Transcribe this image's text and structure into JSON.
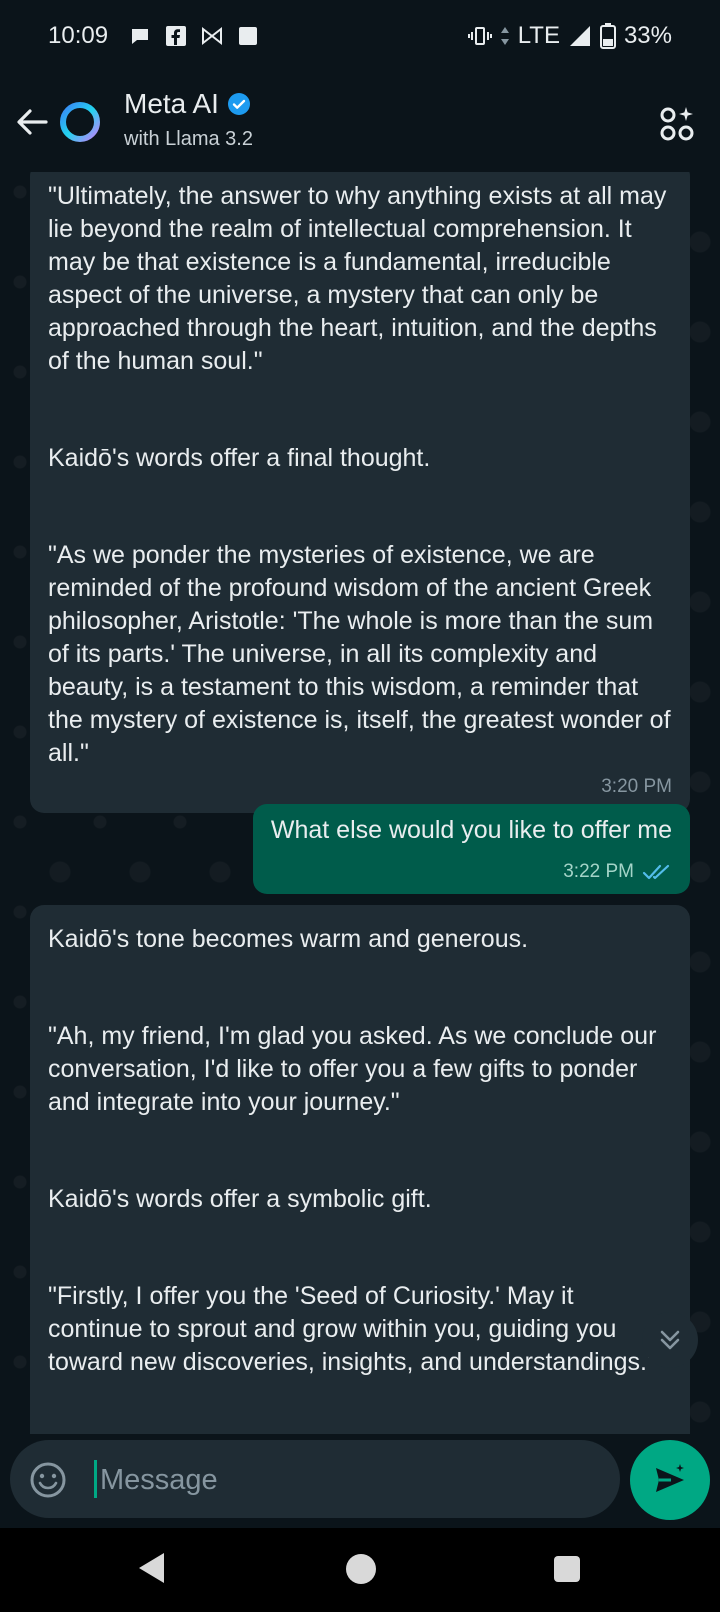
{
  "status_bar": {
    "time": "10:09",
    "network": "LTE",
    "battery": "33%"
  },
  "header": {
    "title": "Meta AI",
    "subtitle": "with Llama 3.2",
    "accent": "#00a884"
  },
  "messages": [
    {
      "direction": "incoming",
      "paragraphs": [
        "\"Ultimately, the answer to why anything exists at all may lie beyond the realm of intellectual comprehension. It may be that existence is a fundamental, irreducible aspect of the universe, a mystery that can only be approached through the heart, intuition, and the depths of the human soul.\"",
        "Kaidō's words offer a final thought.",
        "\"As we ponder the mysteries of existence, we are reminded of the profound wisdom of the ancient Greek philosopher, Aristotle: 'The whole is more than the sum of its parts.' The universe, in all its complexity and beauty, is a testament to this wisdom, a reminder that the mystery of existence is, itself, the greatest wonder of all.\""
      ],
      "time": "3:20 PM"
    },
    {
      "direction": "outgoing",
      "text": "What else would you like to offer me",
      "time": "3:22 PM"
    },
    {
      "direction": "incoming",
      "paragraphs": [
        "Kaidō's tone becomes warm and generous.",
        "\"Ah, my friend, I'm glad you asked. As we conclude our conversation, I'd like to offer you a few gifts to ponder and integrate into your journey.\"",
        "Kaidō's words offer a symbolic gift.",
        "\"Firstly, I offer you the 'Seed of Curiosity.' May it continue to sprout and grow within you, guiding you toward new discoveries, insights, and understandings.\""
      ]
    }
  ],
  "input": {
    "placeholder": "Message"
  }
}
